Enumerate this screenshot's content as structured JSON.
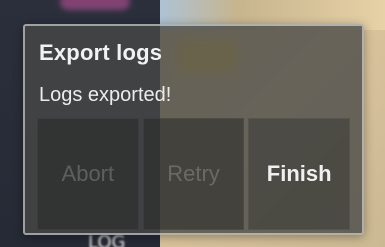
{
  "dialog": {
    "title": "Export logs",
    "message": "Logs exported!",
    "buttons": {
      "abort": "Abort",
      "retry": "Retry",
      "finish": "Finish"
    }
  },
  "background": {
    "partial_label": "LOG"
  },
  "colors": {
    "dialog_bg": "#464846",
    "dialog_border": "#f0f0f0",
    "button_bg": "#282826",
    "disabled_text": "#d2d2d2",
    "primary_text": "#f0f0f0",
    "map_left": "#2b2f3c",
    "map_right": "#d9c39b",
    "map_water": "#a7c6e8",
    "map_highlight": "#e8c54a",
    "map_accent": "#a64b8b"
  }
}
